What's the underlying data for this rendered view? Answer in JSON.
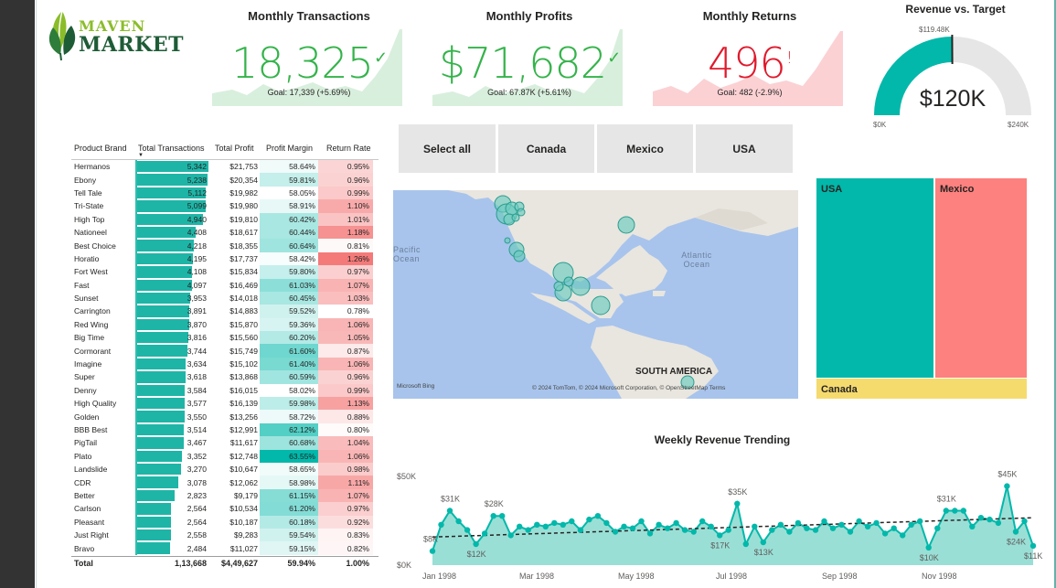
{
  "logo": {
    "line1": "MAVEN",
    "line2": "MARKET"
  },
  "kpis": [
    {
      "title": "Monthly Transactions",
      "value": "18,325",
      "mark": "✓",
      "goal": "Goal: 17,339 (+5.69%)",
      "status": "good"
    },
    {
      "title": "Monthly Profits",
      "value": "$71,682",
      "mark": "✓",
      "goal": "Goal: 67.87K (+5.61%)",
      "status": "good"
    },
    {
      "title": "Monthly Returns",
      "value": "496",
      "mark": "!",
      "goal": "Goal: 482 (-2.9%)",
      "status": "bad"
    }
  ],
  "colors": {
    "good": "#34b34a",
    "bad": "#e0192c",
    "teal": "#01b8aa",
    "red": "#fd817e",
    "yellow": "#f5da6e",
    "goodFill": "#d9efdd",
    "badFill": "#fbd1d4"
  },
  "gauge": {
    "title": "Revenue vs. Target",
    "value": "$120K",
    "target_label": "$119.48K",
    "min_label": "$0K",
    "max_label": "$240K",
    "value_num": 120,
    "target_num": 119.48,
    "max_num": 240
  },
  "slicer": {
    "items": [
      "Select all",
      "Canada",
      "Mexico",
      "USA"
    ]
  },
  "table": {
    "headers": [
      "Product Brand",
      "Total Transactions",
      "Total Profit",
      "Profit Margin",
      "Return Rate"
    ],
    "rows": [
      [
        "Hermanos",
        "5,342",
        "$21,753",
        "58.64%",
        "0.95%"
      ],
      [
        "Ebony",
        "5,238",
        "$20,354",
        "59.81%",
        "0.96%"
      ],
      [
        "Tell Tale",
        "5,112",
        "$19,982",
        "58.05%",
        "0.99%"
      ],
      [
        "Tri-State",
        "5,099",
        "$19,980",
        "58.91%",
        "1.10%"
      ],
      [
        "High Top",
        "4,940",
        "$19,810",
        "60.42%",
        "1.01%"
      ],
      [
        "Nationeel",
        "4,408",
        "$18,617",
        "60.44%",
        "1.18%"
      ],
      [
        "Best Choice",
        "4,218",
        "$18,355",
        "60.64%",
        "0.81%"
      ],
      [
        "Horatio",
        "4,195",
        "$17,737",
        "58.42%",
        "1.26%"
      ],
      [
        "Fort West",
        "4,108",
        "$15,834",
        "59.80%",
        "0.97%"
      ],
      [
        "Fast",
        "4,097",
        "$16,469",
        "61.03%",
        "1.07%"
      ],
      [
        "Sunset",
        "3,953",
        "$14,018",
        "60.45%",
        "1.03%"
      ],
      [
        "Carrington",
        "3,891",
        "$14,883",
        "59.52%",
        "0.78%"
      ],
      [
        "Red Wing",
        "3,870",
        "$15,870",
        "59.36%",
        "1.06%"
      ],
      [
        "Big Time",
        "3,816",
        "$15,560",
        "60.20%",
        "1.05%"
      ],
      [
        "Cormorant",
        "3,744",
        "$15,749",
        "61.60%",
        "0.87%"
      ],
      [
        "Imagine",
        "3,634",
        "$15,102",
        "61.40%",
        "1.06%"
      ],
      [
        "Super",
        "3,618",
        "$13,868",
        "60.59%",
        "0.96%"
      ],
      [
        "Denny",
        "3,584",
        "$16,015",
        "58.02%",
        "0.99%"
      ],
      [
        "High Quality",
        "3,577",
        "$16,139",
        "59.98%",
        "1.13%"
      ],
      [
        "Golden",
        "3,550",
        "$13,256",
        "58.72%",
        "0.88%"
      ],
      [
        "BBB Best",
        "3,514",
        "$12,991",
        "62.12%",
        "0.80%"
      ],
      [
        "PigTail",
        "3,467",
        "$11,617",
        "60.68%",
        "1.04%"
      ],
      [
        "Plato",
        "3,352",
        "$12,748",
        "63.55%",
        "1.06%"
      ],
      [
        "Landslide",
        "3,270",
        "$10,647",
        "58.65%",
        "0.98%"
      ],
      [
        "CDR",
        "3,078",
        "$12,062",
        "58.98%",
        "1.11%"
      ],
      [
        "Better",
        "2,823",
        "$9,179",
        "61.15%",
        "1.07%"
      ],
      [
        "Carlson",
        "2,564",
        "$10,534",
        "61.20%",
        "0.97%"
      ],
      [
        "Pleasant",
        "2,564",
        "$10,187",
        "60.18%",
        "0.92%"
      ],
      [
        "Just Right",
        "2,558",
        "$9,283",
        "59.54%",
        "0.83%"
      ],
      [
        "Bravo",
        "2,484",
        "$11,027",
        "59.15%",
        "0.82%"
      ]
    ],
    "total": [
      "Total",
      "1,13,668",
      "$4,49,627",
      "59.94%",
      "1.00%"
    ]
  },
  "map": {
    "labels": {
      "pacific": "Pacific\nOcean",
      "atlantic": "Atlantic\nOcean",
      "south_america": "SOUTH AMERICA"
    },
    "copyright": "© 2024 TomTom, © 2024 Microsoft Corporation, © OpenStreetMap  Terms",
    "provider": "Microsoft Bing"
  },
  "treemap": {
    "items": [
      {
        "label": "USA",
        "color": "#01b8aa"
      },
      {
        "label": "Mexico",
        "color": "#fd817e"
      },
      {
        "label": "Canada",
        "color": "#f5da6e"
      }
    ]
  },
  "line_chart": {
    "title": "Weekly Revenue Trending",
    "y_ticks": [
      "$50K",
      "$0K"
    ],
    "x_ticks": [
      "Jan 1998",
      "Mar 1998",
      "May 1998",
      "Jul 1998",
      "Sep 1998",
      "Nov 1998"
    ],
    "annotations": [
      "$8K",
      "$31K",
      "$12K",
      "$28K",
      "$35K",
      "$17K",
      "$13K",
      "$31K",
      "$10K",
      "$24K",
      "$45K",
      "$11K"
    ]
  },
  "chart_data": {
    "type": "area",
    "title": "Weekly Revenue Trending",
    "xlabel": "",
    "ylabel": "",
    "ylim": [
      0,
      50
    ],
    "y_unit": "K",
    "series": [
      {
        "values": [
          8,
          23,
          31,
          25,
          20,
          12,
          18,
          28,
          28,
          17,
          22,
          20,
          23,
          22,
          24,
          23,
          25,
          20,
          26,
          28,
          24,
          19,
          22,
          21,
          25,
          18,
          23,
          21,
          24,
          20,
          19,
          25,
          22,
          17,
          20,
          35,
          12,
          22,
          13,
          20,
          23,
          19,
          24,
          21,
          20,
          25,
          21,
          23,
          19,
          25,
          22,
          24,
          18,
          21,
          17,
          23,
          25,
          10,
          21,
          31,
          31,
          31,
          22,
          27,
          26,
          24,
          45,
          19,
          25,
          11
        ]
      }
    ],
    "trend": [
      16,
      27
    ],
    "x_labels": [
      "Jan 1998",
      "Mar 1998",
      "May 1998",
      "Jul 1998",
      "Sep 1998",
      "Nov 1998"
    ]
  }
}
